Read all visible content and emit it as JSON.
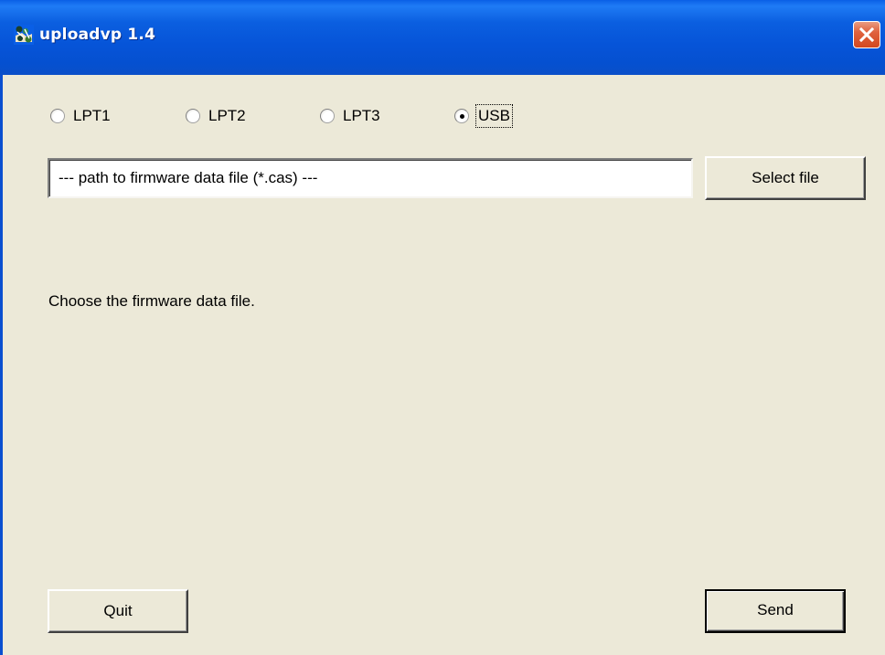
{
  "window": {
    "title": "uploadvp 1.4",
    "icon": "app-icon",
    "close_icon": "close-icon",
    "colors": {
      "titlebar": "#0654D8",
      "background": "#ECE9D8",
      "close_button": "#E0623E"
    }
  },
  "port_options": [
    {
      "label": "LPT1",
      "selected": false
    },
    {
      "label": "LPT2",
      "selected": false
    },
    {
      "label": "LPT3",
      "selected": false
    },
    {
      "label": "USB",
      "selected": true
    }
  ],
  "file": {
    "path_text": "--- path to firmware data file (*.cas)  ---",
    "select_label": "Select file"
  },
  "status": {
    "message": "Choose the firmware data file."
  },
  "actions": {
    "quit_label": "Quit",
    "send_label": "Send"
  }
}
